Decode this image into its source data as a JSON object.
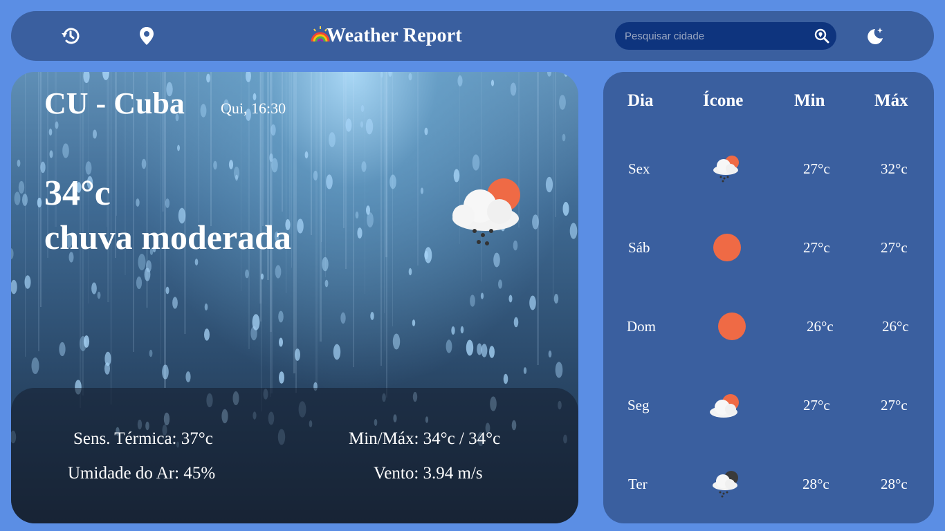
{
  "header": {
    "history_icon": "history-icon",
    "location_icon": "map-pin-icon",
    "logo_icon": "rainbow-weather-logo",
    "title": "Weather Report",
    "search": {
      "placeholder": "Pesquisar cidade",
      "value": "",
      "icon": "search-location-icon"
    },
    "theme_icon": "moon-stars-icon"
  },
  "current": {
    "location": "CU - Cuba",
    "datetime": "Qui, 16:30",
    "temperature": "34°c",
    "description": "chuva moderada",
    "icon": "cloud-sun-rain-icon",
    "details": {
      "feels_like": "Sens. Térmica: 37°c",
      "min_max": "Min/Máx: 34°c / 34°c",
      "humidity": "Umidade do Ar: 45%",
      "wind": "Vento: 3.94 m/s"
    }
  },
  "forecast": {
    "headers": {
      "day": "Dia",
      "icon": "Ícone",
      "min": "Min",
      "max": "Máx"
    },
    "rows": [
      {
        "day": "Sex",
        "icon": "cloud-sun-rain-icon",
        "min": "27°c",
        "max": "32°c"
      },
      {
        "day": "Sáb",
        "icon": "sun-icon",
        "min": "27°c",
        "max": "27°c"
      },
      {
        "day": "Dom",
        "icon": "sun-icon",
        "min": "26°c",
        "max": "26°c"
      },
      {
        "day": "Seg",
        "icon": "cloud-sun-icon",
        "min": "27°c",
        "max": "27°c"
      },
      {
        "day": "Ter",
        "icon": "cloud-rain-night-icon",
        "min": "28°c",
        "max": "28°c"
      }
    ]
  },
  "colors": {
    "page_bg": "#5b8ee4",
    "panel_bg": "#3a5f9f",
    "search_bg": "#0e347e",
    "sun": "#ef6a45",
    "text": "#ffffff"
  }
}
